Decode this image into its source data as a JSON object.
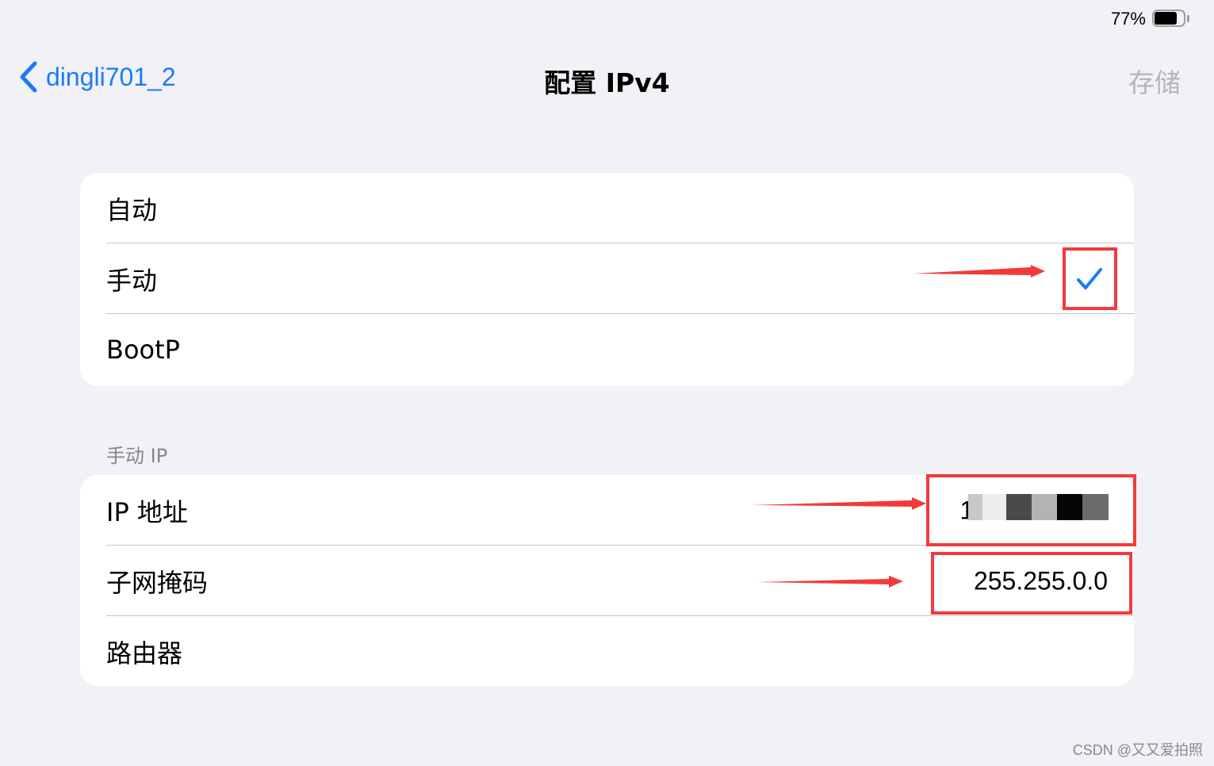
{
  "status_bar": {
    "battery_percent_label": "77%",
    "battery_level": 0.77
  },
  "nav": {
    "back_label": "dingli701_2",
    "title": "配置 IPv4",
    "save_label": "存储"
  },
  "config_methods": [
    {
      "label": "自动",
      "selected": false
    },
    {
      "label": "手动",
      "selected": true
    },
    {
      "label": "BootP",
      "selected": false
    }
  ],
  "manual_ip": {
    "section_header": "手动 IP",
    "rows": [
      {
        "label": "IP 地址",
        "value": "19",
        "value_obscured": true
      },
      {
        "label": "子网掩码",
        "value": "255.255.0.0"
      },
      {
        "label": "路由器",
        "value": ""
      }
    ]
  },
  "colors": {
    "accent": "#1a7cf6",
    "annotation": "#f23a3a",
    "background": "#f1f1f6",
    "disabled": "#b5b5ba"
  },
  "watermark": "CSDN @又又爱拍照"
}
